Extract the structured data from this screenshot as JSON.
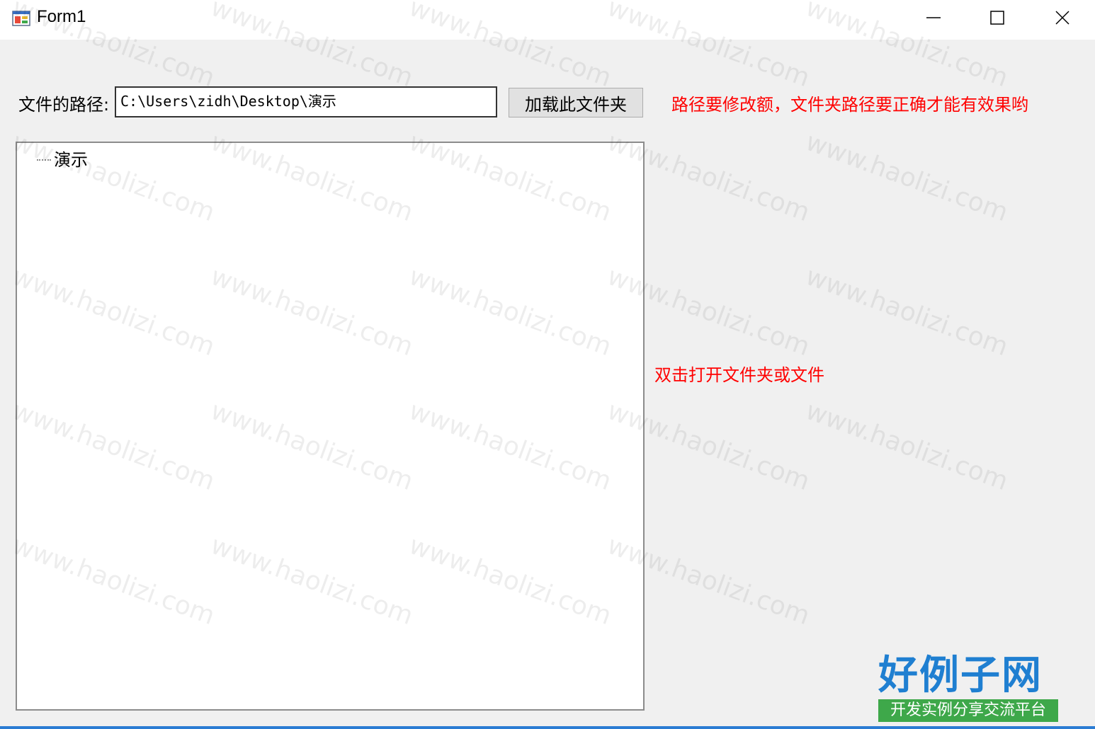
{
  "window": {
    "title": "Form1",
    "icon": "winforms-app-icon",
    "controls": [
      "minimize-icon",
      "maximize-icon",
      "close-icon"
    ]
  },
  "form": {
    "path_label": "文件的路径:",
    "path_value": "C:\\Users\\zidh\\Desktop\\演示",
    "load_button_label": "加载此文件夹",
    "hint_top": "路径要修改额，文件夹路径要正确才能有效果哟",
    "hint_middle": "双击打开文件夹或文件",
    "hint_color": "#ff0000"
  },
  "tree": {
    "nodes": [
      {
        "label": "演示"
      }
    ]
  },
  "watermark": {
    "text": "www.haolizi.com",
    "logo_main": "好例子网",
    "logo_sub": "开发实例分享交流平台",
    "logo_color": "#1f7fd1",
    "logo_sub_bg": "#3ea84a"
  }
}
